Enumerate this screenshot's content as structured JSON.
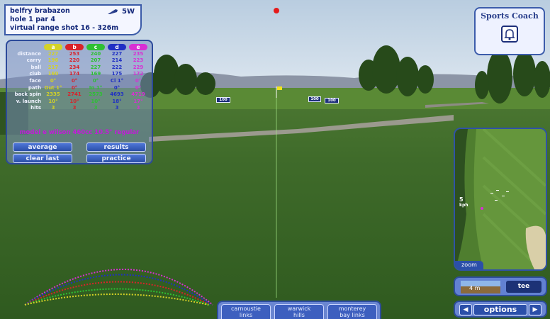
{
  "header": {
    "line1": "belfry brabazon",
    "line2": "hole 1 par 4",
    "line3": "virtual range shot 16 - 326m",
    "club": "5W"
  },
  "stats": {
    "shot_cols": [
      {
        "label": "a",
        "color": "#d4d226"
      },
      {
        "label": "b",
        "color": "#d9222a"
      },
      {
        "label": "c",
        "color": "#2ec033"
      },
      {
        "label": "d",
        "color": "#1f2fc4"
      },
      {
        "label": "e",
        "color": "#d82fd4"
      }
    ],
    "rows": [
      {
        "label": "distance",
        "values": [
          "227",
          "253",
          "240",
          "227",
          "235"
        ]
      },
      {
        "label": "carry",
        "values": [
          "196",
          "220",
          "207",
          "214",
          "223"
        ]
      },
      {
        "label": "ball",
        "values": [
          "217",
          "234",
          "227",
          "222",
          "229"
        ]
      },
      {
        "label": "club",
        "values": [
          "160",
          "174",
          "169",
          "175",
          "172"
        ]
      },
      {
        "label": "face",
        "values": [
          "0°",
          "0°",
          "0°",
          "Cl 1°",
          "0°"
        ]
      },
      {
        "label": "path",
        "values": [
          "Out 1°",
          "0°",
          "In 1°",
          "0°",
          "0°"
        ]
      },
      {
        "label": "back spin",
        "values": [
          "2335",
          "2741",
          "2573",
          "4693",
          "4719"
        ]
      },
      {
        "label": "v. launch",
        "values": [
          "10°",
          "10°",
          "10°",
          "18°",
          "17°"
        ]
      },
      {
        "label": "hits",
        "values": [
          "3",
          "3",
          "3",
          "3",
          "3"
        ]
      }
    ],
    "model": "model e wilson 460cc 10.5° regular",
    "buttons": {
      "average": "average",
      "results": "results",
      "clear_last": "clear last",
      "practice": "practice"
    }
  },
  "coach": {
    "title": "Sports Coach"
  },
  "minimap": {
    "zoom": "zoom",
    "wind_speed": "5",
    "wind_unit": "kph"
  },
  "elevation": {
    "distance": "4 m",
    "tee": "tee"
  },
  "options": {
    "label": "options"
  },
  "courses": [
    {
      "line1": "carnoustie",
      "line2": "links"
    },
    {
      "line1": "warwick",
      "line2": "hills"
    },
    {
      "line1": "monterey",
      "line2": "bay links"
    }
  ],
  "signs": [
    "100",
    "100",
    "100"
  ],
  "colors": {
    "panel": "#2c4a9a",
    "button": "#2b4fa9",
    "sky": "#c2d3e4",
    "grass": "#3f6d2a"
  }
}
